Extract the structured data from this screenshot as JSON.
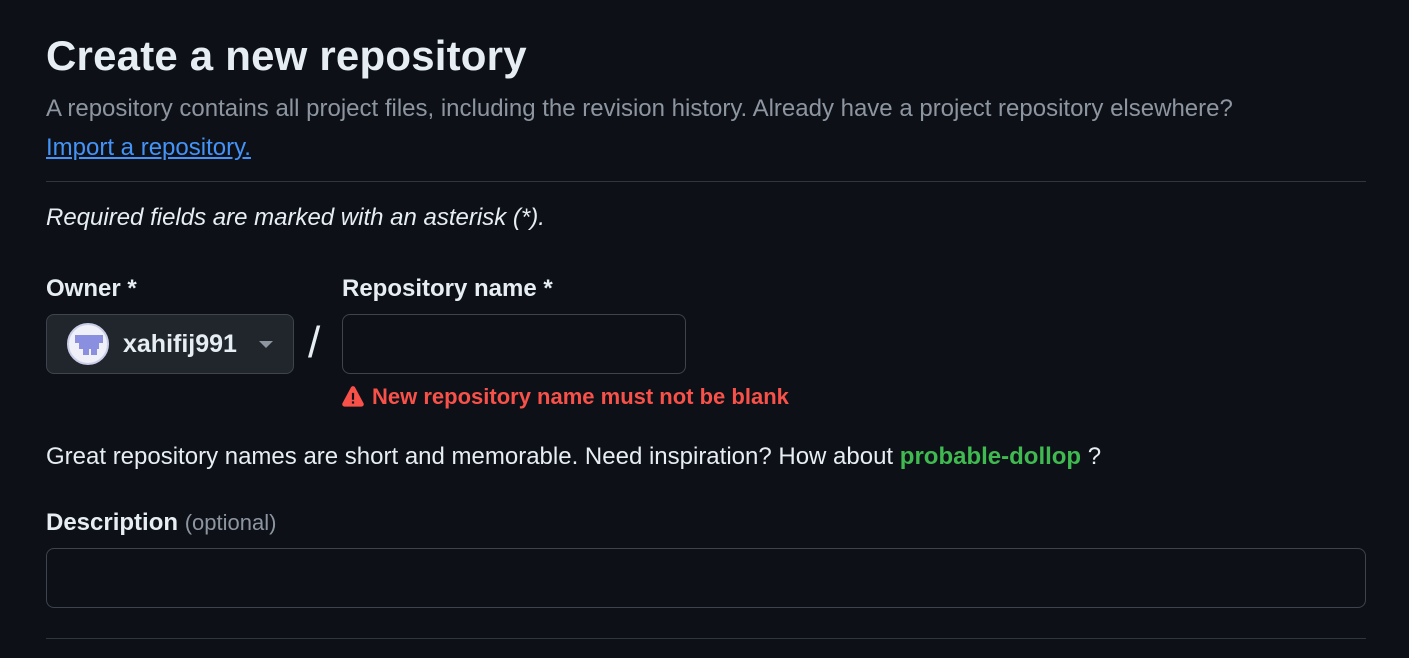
{
  "header": {
    "title": "Create a new repository",
    "subtitle": "A repository contains all project files, including the revision history. Already have a project repository elsewhere?",
    "import_link": "Import a repository."
  },
  "form": {
    "required_note": "Required fields are marked with an asterisk (*).",
    "owner": {
      "label": "Owner *",
      "value": "xahifij991"
    },
    "separator": "/",
    "repo_name": {
      "label": "Repository name *",
      "value": "",
      "placeholder": ""
    },
    "error_message": "New repository name must not be blank",
    "hint_prefix": "Great repository names are short and memorable. Need inspiration? How about",
    "suggestion": "probable-dollop",
    "hint_suffix": "?",
    "description": {
      "label": "Description",
      "optional": "(optional)",
      "value": "",
      "placeholder": ""
    }
  },
  "colors": {
    "background": "#0d1117",
    "link": "#4493f8",
    "error": "#f85149",
    "suggestion": "#3fb950",
    "muted": "#8d96a0"
  },
  "icons": [
    "avatar",
    "chevron-down-icon",
    "alert-icon"
  ]
}
